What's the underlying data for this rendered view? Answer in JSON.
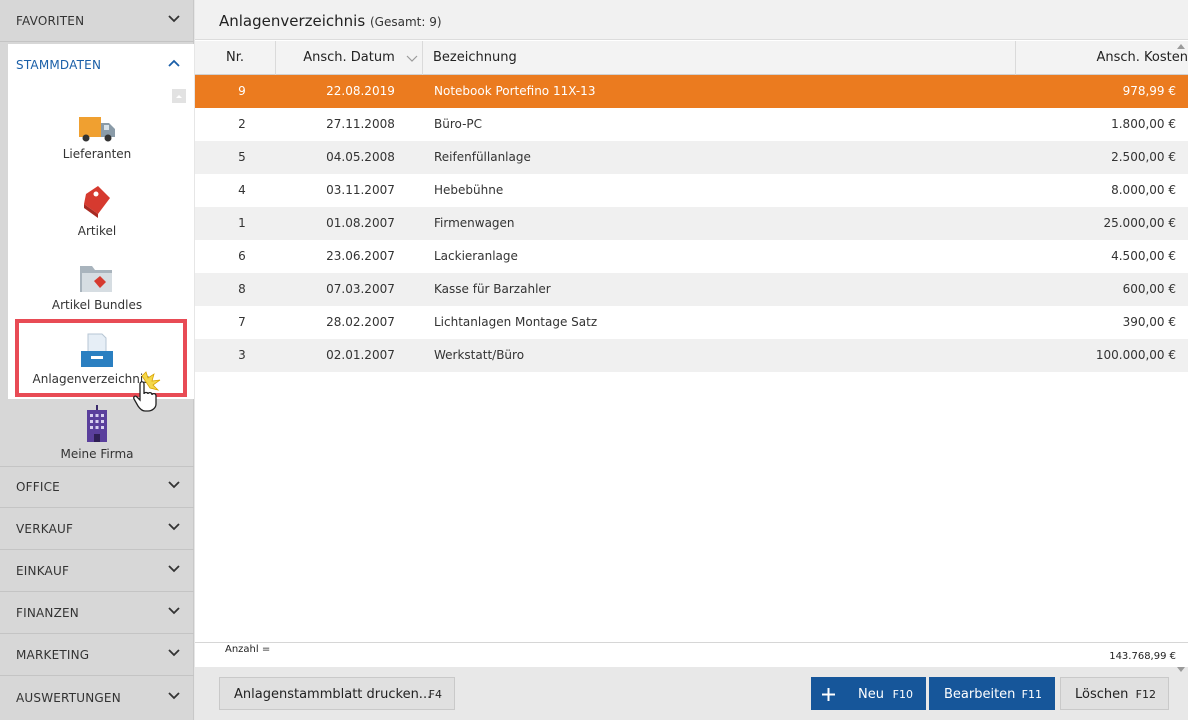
{
  "sidebar": {
    "favoriten": "FAVORITEN",
    "stammdaten": "STAMMDATEN",
    "tiles": [
      {
        "label": "Lieferanten",
        "icon": "truck-icon"
      },
      {
        "label": "Artikel",
        "icon": "price-tag-icon"
      },
      {
        "label": "Artikel Bundles",
        "icon": "folder-tag-icon"
      },
      {
        "label": "Anlagenverzeichnis",
        "icon": "inbox-tray-icon"
      },
      {
        "label": "Meine Firma",
        "icon": "office-building-icon"
      }
    ],
    "sections": [
      "OFFICE",
      "VERKAUF",
      "EINKAUF",
      "FINANZEN",
      "MARKETING",
      "AUSWERTUNGEN"
    ]
  },
  "main": {
    "title": "Anlagenverzeichnis",
    "count": "(Gesamt: 9)"
  },
  "table": {
    "columns": {
      "nr": "Nr.",
      "date": "Ansch. Datum",
      "bez": "Bezeichnung",
      "cost": "Ansch. Kosten"
    },
    "rows": [
      {
        "nr": "9",
        "date": "22.08.2019",
        "bez": "Notebook Portefino 11X-13",
        "cost": "978,99 €"
      },
      {
        "nr": "2",
        "date": "27.11.2008",
        "bez": "Büro-PC",
        "cost": "1.800,00 €"
      },
      {
        "nr": "5",
        "date": "04.05.2008",
        "bez": "Reifenfüllanlage",
        "cost": "2.500,00 €"
      },
      {
        "nr": "4",
        "date": "03.11.2007",
        "bez": "Hebebühne",
        "cost": "8.000,00 €"
      },
      {
        "nr": "1",
        "date": "01.08.2007",
        "bez": "Firmenwagen",
        "cost": "25.000,00 €"
      },
      {
        "nr": "6",
        "date": "23.06.2007",
        "bez": "Lackieranlage",
        "cost": "4.500,00 €"
      },
      {
        "nr": "8",
        "date": "07.03.2007",
        "bez": "Kasse für Barzahler",
        "cost": "600,00 €"
      },
      {
        "nr": "7",
        "date": "28.02.2007",
        "bez": "Lichtanlagen Montage Satz",
        "cost": "390,00 €"
      },
      {
        "nr": "3",
        "date": "02.01.2007",
        "bez": "Werkstatt/Büro",
        "cost": "100.000,00 €"
      }
    ]
  },
  "footer": {
    "anzahl": "Anzahl =",
    "sum": "143.768,99 €"
  },
  "buttons": {
    "print": "Anlagenstammblatt drucken...",
    "print_key": "F4",
    "new": "Neu",
    "new_key": "F10",
    "edit": "Bearbeiten",
    "edit_key": "F11",
    "delete": "Löschen",
    "delete_key": "F12"
  },
  "colors": {
    "selection": "#eb7b1f",
    "primary": "#16569a",
    "highlight": "#e84b55",
    "link": "#1a5fa8"
  }
}
